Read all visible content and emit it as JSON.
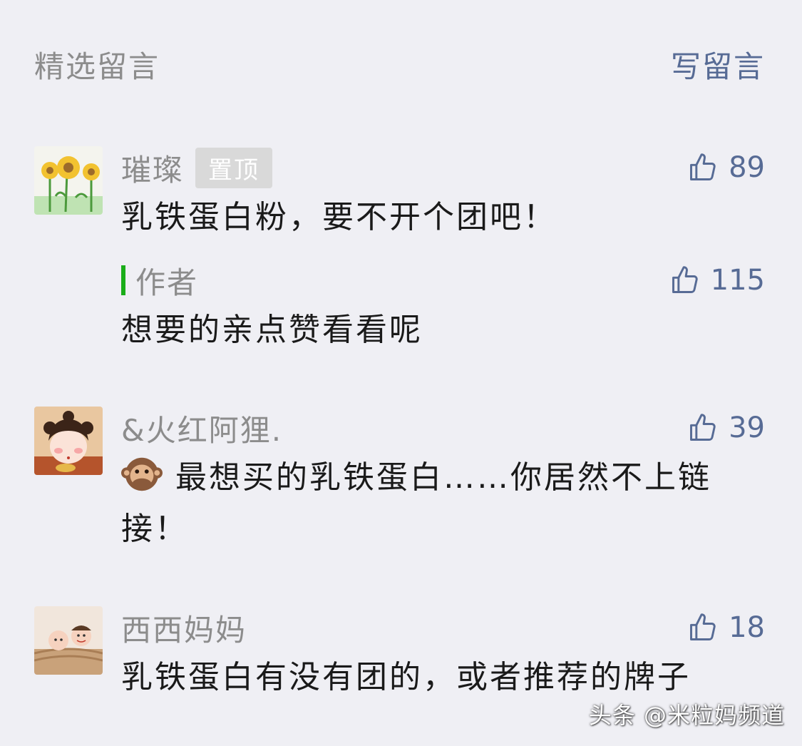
{
  "header": {
    "title": "精选留言",
    "write_label": "写留言"
  },
  "comments": [
    {
      "nickname": "璀璨",
      "badge": "置顶",
      "likes": "89",
      "text": "乳铁蛋白粉，要不开个团吧！",
      "avatar_icon": "sunflower-drawing",
      "reply": {
        "author": "作者",
        "likes": "115",
        "text": "想要的亲点赞看看呢"
      }
    },
    {
      "nickname": "&火红阿狸.",
      "likes": "39",
      "emoji": "speak-no-evil-monkey-emoji",
      "text": "最想买的乳铁蛋白……你居然不上链接！",
      "avatar_icon": "cartoon-girl"
    },
    {
      "nickname": "西西妈妈",
      "likes": "18",
      "text": "乳铁蛋白有没有团的，或者推荐的牌子",
      "avatar_icon": "baby-photo"
    }
  ],
  "watermark": "头条 @米粒妈频道",
  "colors": {
    "background": "#efeff4",
    "link_blue": "#576b95",
    "gray_text": "#8c8c8c",
    "author_bar_green": "#1aad19",
    "badge_gray": "#d9d9d9"
  }
}
